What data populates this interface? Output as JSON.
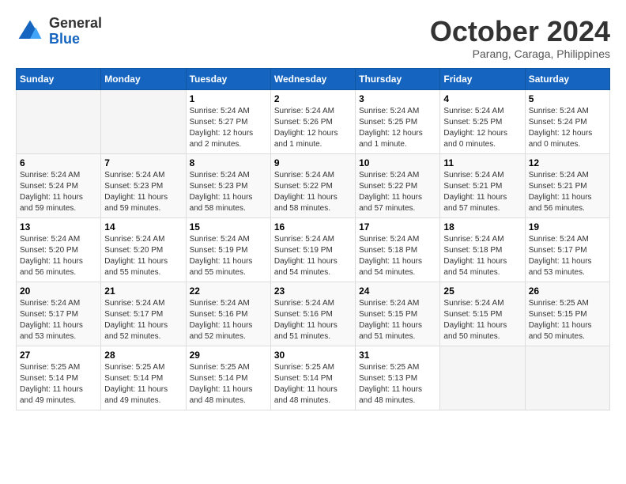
{
  "header": {
    "logo_line1": "General",
    "logo_line2": "Blue",
    "month_title": "October 2024",
    "location": "Parang, Caraga, Philippines"
  },
  "weekdays": [
    "Sunday",
    "Monday",
    "Tuesday",
    "Wednesday",
    "Thursday",
    "Friday",
    "Saturday"
  ],
  "weeks": [
    [
      {
        "num": "",
        "sunrise": "",
        "sunset": "",
        "daylight": "",
        "empty": true
      },
      {
        "num": "",
        "sunrise": "",
        "sunset": "",
        "daylight": "",
        "empty": true
      },
      {
        "num": "1",
        "sunrise": "Sunrise: 5:24 AM",
        "sunset": "Sunset: 5:27 PM",
        "daylight": "Daylight: 12 hours and 2 minutes."
      },
      {
        "num": "2",
        "sunrise": "Sunrise: 5:24 AM",
        "sunset": "Sunset: 5:26 PM",
        "daylight": "Daylight: 12 hours and 1 minute."
      },
      {
        "num": "3",
        "sunrise": "Sunrise: 5:24 AM",
        "sunset": "Sunset: 5:25 PM",
        "daylight": "Daylight: 12 hours and 1 minute."
      },
      {
        "num": "4",
        "sunrise": "Sunrise: 5:24 AM",
        "sunset": "Sunset: 5:25 PM",
        "daylight": "Daylight: 12 hours and 0 minutes."
      },
      {
        "num": "5",
        "sunrise": "Sunrise: 5:24 AM",
        "sunset": "Sunset: 5:24 PM",
        "daylight": "Daylight: 12 hours and 0 minutes."
      }
    ],
    [
      {
        "num": "6",
        "sunrise": "Sunrise: 5:24 AM",
        "sunset": "Sunset: 5:24 PM",
        "daylight": "Daylight: 11 hours and 59 minutes."
      },
      {
        "num": "7",
        "sunrise": "Sunrise: 5:24 AM",
        "sunset": "Sunset: 5:23 PM",
        "daylight": "Daylight: 11 hours and 59 minutes."
      },
      {
        "num": "8",
        "sunrise": "Sunrise: 5:24 AM",
        "sunset": "Sunset: 5:23 PM",
        "daylight": "Daylight: 11 hours and 58 minutes."
      },
      {
        "num": "9",
        "sunrise": "Sunrise: 5:24 AM",
        "sunset": "Sunset: 5:22 PM",
        "daylight": "Daylight: 11 hours and 58 minutes."
      },
      {
        "num": "10",
        "sunrise": "Sunrise: 5:24 AM",
        "sunset": "Sunset: 5:22 PM",
        "daylight": "Daylight: 11 hours and 57 minutes."
      },
      {
        "num": "11",
        "sunrise": "Sunrise: 5:24 AM",
        "sunset": "Sunset: 5:21 PM",
        "daylight": "Daylight: 11 hours and 57 minutes."
      },
      {
        "num": "12",
        "sunrise": "Sunrise: 5:24 AM",
        "sunset": "Sunset: 5:21 PM",
        "daylight": "Daylight: 11 hours and 56 minutes."
      }
    ],
    [
      {
        "num": "13",
        "sunrise": "Sunrise: 5:24 AM",
        "sunset": "Sunset: 5:20 PM",
        "daylight": "Daylight: 11 hours and 56 minutes."
      },
      {
        "num": "14",
        "sunrise": "Sunrise: 5:24 AM",
        "sunset": "Sunset: 5:20 PM",
        "daylight": "Daylight: 11 hours and 55 minutes."
      },
      {
        "num": "15",
        "sunrise": "Sunrise: 5:24 AM",
        "sunset": "Sunset: 5:19 PM",
        "daylight": "Daylight: 11 hours and 55 minutes."
      },
      {
        "num": "16",
        "sunrise": "Sunrise: 5:24 AM",
        "sunset": "Sunset: 5:19 PM",
        "daylight": "Daylight: 11 hours and 54 minutes."
      },
      {
        "num": "17",
        "sunrise": "Sunrise: 5:24 AM",
        "sunset": "Sunset: 5:18 PM",
        "daylight": "Daylight: 11 hours and 54 minutes."
      },
      {
        "num": "18",
        "sunrise": "Sunrise: 5:24 AM",
        "sunset": "Sunset: 5:18 PM",
        "daylight": "Daylight: 11 hours and 54 minutes."
      },
      {
        "num": "19",
        "sunrise": "Sunrise: 5:24 AM",
        "sunset": "Sunset: 5:17 PM",
        "daylight": "Daylight: 11 hours and 53 minutes."
      }
    ],
    [
      {
        "num": "20",
        "sunrise": "Sunrise: 5:24 AM",
        "sunset": "Sunset: 5:17 PM",
        "daylight": "Daylight: 11 hours and 53 minutes."
      },
      {
        "num": "21",
        "sunrise": "Sunrise: 5:24 AM",
        "sunset": "Sunset: 5:17 PM",
        "daylight": "Daylight: 11 hours and 52 minutes."
      },
      {
        "num": "22",
        "sunrise": "Sunrise: 5:24 AM",
        "sunset": "Sunset: 5:16 PM",
        "daylight": "Daylight: 11 hours and 52 minutes."
      },
      {
        "num": "23",
        "sunrise": "Sunrise: 5:24 AM",
        "sunset": "Sunset: 5:16 PM",
        "daylight": "Daylight: 11 hours and 51 minutes."
      },
      {
        "num": "24",
        "sunrise": "Sunrise: 5:24 AM",
        "sunset": "Sunset: 5:15 PM",
        "daylight": "Daylight: 11 hours and 51 minutes."
      },
      {
        "num": "25",
        "sunrise": "Sunrise: 5:24 AM",
        "sunset": "Sunset: 5:15 PM",
        "daylight": "Daylight: 11 hours and 50 minutes."
      },
      {
        "num": "26",
        "sunrise": "Sunrise: 5:25 AM",
        "sunset": "Sunset: 5:15 PM",
        "daylight": "Daylight: 11 hours and 50 minutes."
      }
    ],
    [
      {
        "num": "27",
        "sunrise": "Sunrise: 5:25 AM",
        "sunset": "Sunset: 5:14 PM",
        "daylight": "Daylight: 11 hours and 49 minutes."
      },
      {
        "num": "28",
        "sunrise": "Sunrise: 5:25 AM",
        "sunset": "Sunset: 5:14 PM",
        "daylight": "Daylight: 11 hours and 49 minutes."
      },
      {
        "num": "29",
        "sunrise": "Sunrise: 5:25 AM",
        "sunset": "Sunset: 5:14 PM",
        "daylight": "Daylight: 11 hours and 48 minutes."
      },
      {
        "num": "30",
        "sunrise": "Sunrise: 5:25 AM",
        "sunset": "Sunset: 5:14 PM",
        "daylight": "Daylight: 11 hours and 48 minutes."
      },
      {
        "num": "31",
        "sunrise": "Sunrise: 5:25 AM",
        "sunset": "Sunset: 5:13 PM",
        "daylight": "Daylight: 11 hours and 48 minutes."
      },
      {
        "num": "",
        "sunrise": "",
        "sunset": "",
        "daylight": "",
        "empty": true
      },
      {
        "num": "",
        "sunrise": "",
        "sunset": "",
        "daylight": "",
        "empty": true
      }
    ]
  ]
}
